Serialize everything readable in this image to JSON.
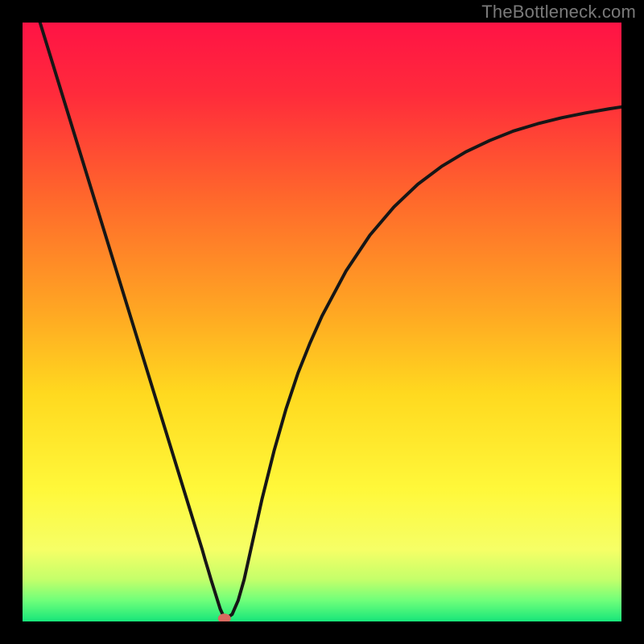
{
  "attribution": "TheBottleneck.com",
  "chart_data": {
    "type": "line",
    "title": "",
    "xlabel": "",
    "ylabel": "",
    "xlim": [
      0,
      100
    ],
    "ylim": [
      0,
      100
    ],
    "series": [
      {
        "name": "bottleneck-curve",
        "x": [
          0,
          2,
          4,
          6,
          8,
          10,
          12,
          14,
          16,
          18,
          20,
          22,
          24,
          26,
          28,
          29,
          30,
          30.5,
          31,
          31.5,
          32,
          32.5,
          33,
          33.5,
          34,
          35,
          36,
          37,
          38,
          40,
          42,
          44,
          46,
          48,
          50,
          54,
          58,
          62,
          66,
          70,
          74,
          78,
          82,
          86,
          90,
          94,
          98,
          100
        ],
        "y": [
          110,
          103,
          96.5,
          90,
          83.5,
          77,
          70.5,
          64,
          57.5,
          51,
          44.5,
          38,
          31.5,
          25,
          18.5,
          15.25,
          12,
          10.25,
          8.6,
          6.9,
          5.3,
          3.7,
          2.1,
          1.0,
          0.5,
          1.2,
          3.5,
          7.0,
          11.5,
          20.5,
          28.5,
          35.5,
          41.5,
          46.5,
          51,
          58.5,
          64.5,
          69.2,
          73,
          76,
          78.4,
          80.3,
          81.9,
          83.1,
          84.1,
          84.9,
          85.6,
          85.9
        ]
      }
    ],
    "marker": {
      "x": 33.7,
      "y": 0.5,
      "color": "#d86a60",
      "rx": 8,
      "ry": 6
    },
    "gradient_stops": [
      {
        "pct": 0,
        "color": "#ff1345"
      },
      {
        "pct": 12,
        "color": "#ff2b3b"
      },
      {
        "pct": 30,
        "color": "#ff6a2b"
      },
      {
        "pct": 48,
        "color": "#ffa623"
      },
      {
        "pct": 62,
        "color": "#ffd91f"
      },
      {
        "pct": 78,
        "color": "#fff83a"
      },
      {
        "pct": 88,
        "color": "#f6ff66"
      },
      {
        "pct": 93,
        "color": "#c4ff6a"
      },
      {
        "pct": 96.5,
        "color": "#6fff7a"
      },
      {
        "pct": 100,
        "color": "#17e67a"
      }
    ],
    "curve_stroke": "#161616",
    "curve_width": 4
  }
}
